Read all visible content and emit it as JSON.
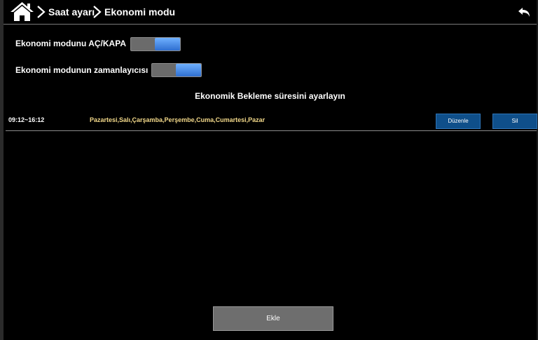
{
  "header": {
    "home_icon": "home-icon",
    "breadcrumb": [
      "Saat ayarı",
      "Ekonomi modu"
    ],
    "back_icon": "back-arrow-icon"
  },
  "settings": {
    "economy_toggle": {
      "label": "Ekonomi modunu AÇ/KAPA",
      "state": "on"
    },
    "economy_timer_toggle": {
      "label": "Ekonomi modunun zamanlayıcısı",
      "state": "on"
    }
  },
  "section_title": "Ekonomik Bekleme süresini ayarlayın",
  "schedules": [
    {
      "time": "09:12~16:12",
      "days": "Pazartesi,Salı,Çarşamba,Perşembe,Cuma,Cumartesi,Pazar",
      "edit_label": "Düzenle",
      "delete_label": "Sil"
    }
  ],
  "add_button_label": "Ekle",
  "colors": {
    "background": "#000000",
    "toggle_on": "#3f86e0",
    "days_text": "#f3d98a",
    "row_button": "#0f4f8a",
    "add_button": "#6e6e6e"
  }
}
